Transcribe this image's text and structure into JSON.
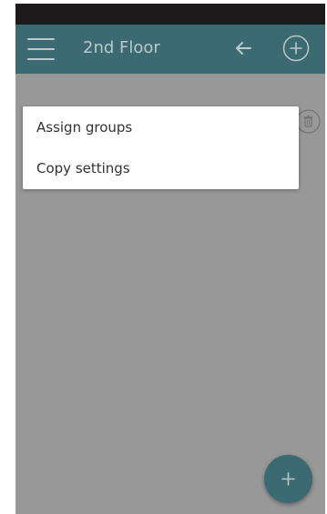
{
  "header": {
    "title": "2nd Floor"
  },
  "icons": {
    "menu": "hamburger-menu-icon",
    "back": "arrow-left-icon",
    "add": "plus-circle-icon",
    "delete": "trash-icon",
    "fab": "plus-icon"
  },
  "context_menu": {
    "items": [
      {
        "label": "Assign groups"
      },
      {
        "label": "Copy settings"
      }
    ]
  },
  "colors": {
    "app_bar": "#3b6a72",
    "status_bar": "#1c1a1b",
    "overlay_background": "#989898",
    "menu_background": "#ffffff"
  }
}
